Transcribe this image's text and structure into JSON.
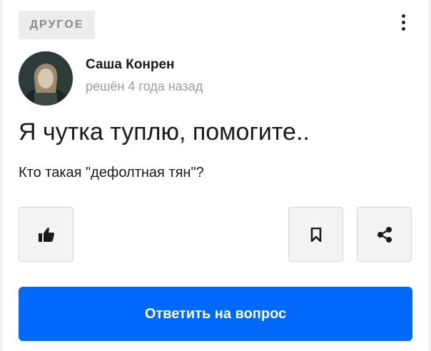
{
  "question": {
    "category": "ДРУГОЕ",
    "author": {
      "name": "Саша Конрен",
      "meta": "решён 4 года назад"
    },
    "title": "Я чутка туплю, помогите..",
    "body": "Кто такая \"дефолтная тян\"?"
  },
  "actions": {
    "like_icon": "thumbs-up-icon",
    "bookmark_icon": "bookmark-icon",
    "share_icon": "share-icon",
    "more_icon": "more-vertical-icon",
    "answer_label": "Ответить на вопрос"
  },
  "colors": {
    "primary": "#0068fb",
    "text": "#1a1a1a",
    "muted": "#9a9a9a",
    "category_bg": "#ececec"
  }
}
